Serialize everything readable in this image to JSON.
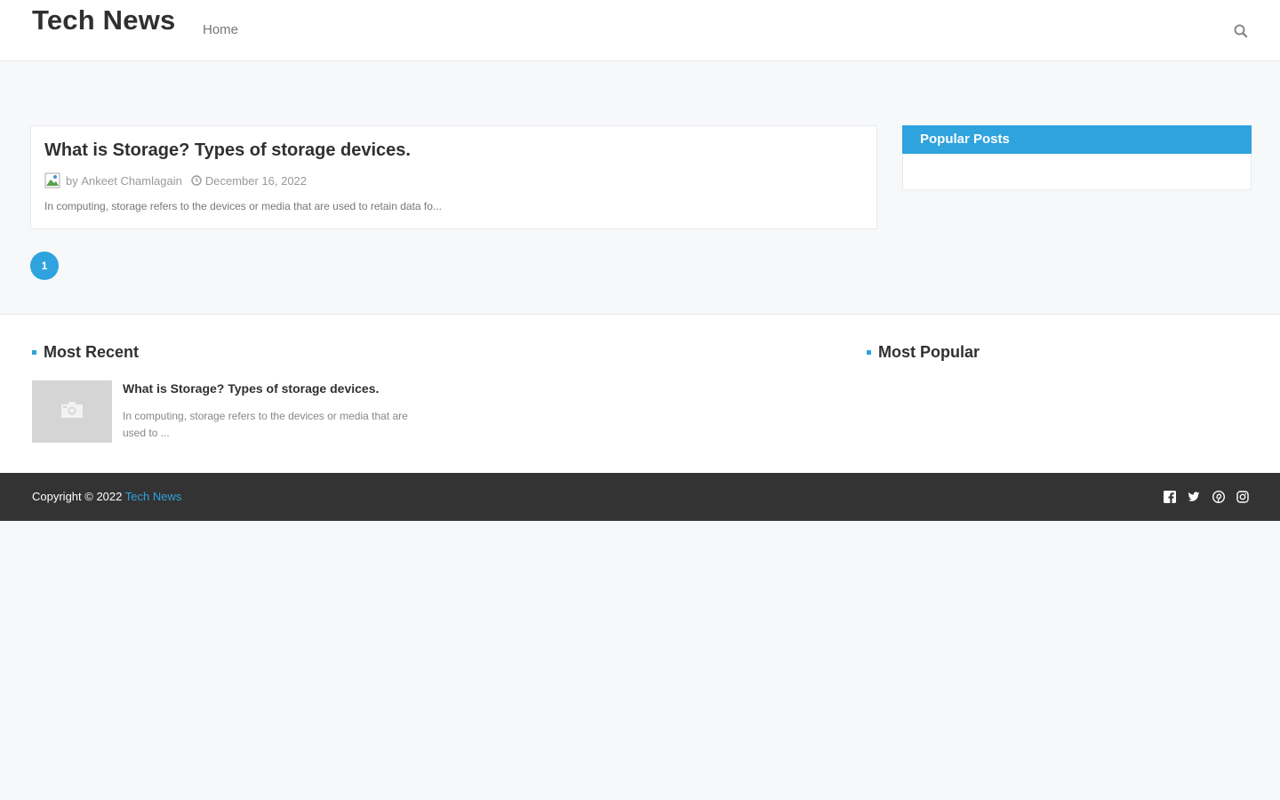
{
  "header": {
    "site_title": "Tech News",
    "nav": [
      {
        "label": "Home"
      }
    ],
    "search_icon": "search-icon"
  },
  "main": {
    "posts": [
      {
        "title": "What is Storage? Types of storage devices.",
        "author_prefix": "by",
        "author": "Ankeet Chamlagain",
        "date": "December 16, 2022",
        "snippet": "In computing, storage refers to the devices or media that are used to retain data fo..."
      }
    ],
    "pagination": {
      "current_page": "1"
    }
  },
  "sidebar": {
    "popular_posts_title": "Popular Posts"
  },
  "footer_widgets": {
    "most_recent_title": "Most Recent",
    "most_popular_title": "Most Popular",
    "recent_items": [
      {
        "title": "What is Storage? Types of storage devices.",
        "snippet": "In computing, storage refers to the devices or media that are used to ..."
      }
    ]
  },
  "footer": {
    "copyright_text": "Copyright © 2022",
    "copyright_link": "Tech News",
    "social_icons": [
      "facebook-icon",
      "twitter-icon",
      "pinterest-icon",
      "instagram-icon"
    ]
  },
  "colors": {
    "accent": "#2ea3dd",
    "footer_bg": "#333333",
    "page_bg": "#f6f8fa"
  }
}
